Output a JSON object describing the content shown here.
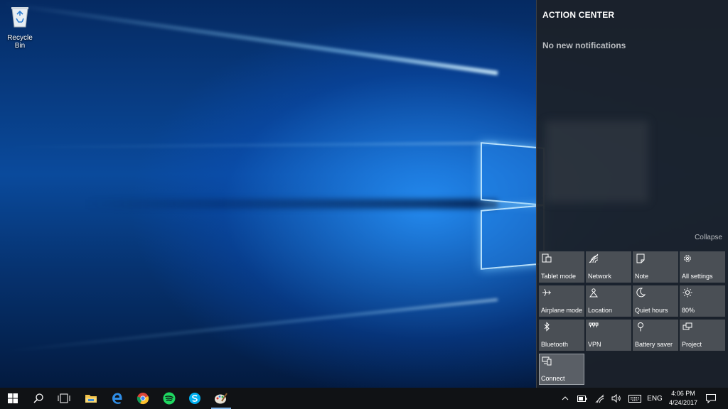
{
  "desktop": {
    "icons": [
      {
        "label": "Recycle Bin",
        "icon": "recycle-bin-icon"
      }
    ]
  },
  "action_center": {
    "title": "ACTION CENTER",
    "empty_message": "No new notifications",
    "collapse_label": "Collapse",
    "quick_actions": [
      {
        "label": "Tablet mode",
        "icon": "tablet-mode-icon"
      },
      {
        "label": "Network",
        "icon": "network-icon"
      },
      {
        "label": "Note",
        "icon": "note-icon"
      },
      {
        "label": "All settings",
        "icon": "gear-icon"
      },
      {
        "label": "Airplane mode",
        "icon": "airplane-icon"
      },
      {
        "label": "Location",
        "icon": "location-icon"
      },
      {
        "label": "Quiet hours",
        "icon": "moon-icon"
      },
      {
        "label": "80%",
        "icon": "brightness-icon"
      },
      {
        "label": "Bluetooth",
        "icon": "bluetooth-icon"
      },
      {
        "label": "VPN",
        "icon": "vpn-icon"
      },
      {
        "label": "Battery saver",
        "icon": "battery-saver-icon"
      },
      {
        "label": "Project",
        "icon": "project-icon"
      },
      {
        "label": "Connect",
        "icon": "connect-icon"
      }
    ]
  },
  "taskbar": {
    "pinned": [
      "start-icon",
      "search-icon",
      "task-view-icon",
      "file-explorer-icon",
      "edge-icon",
      "chrome-icon",
      "spotify-icon",
      "skype-icon",
      "paint-icon"
    ],
    "tray": {
      "language": "ENG",
      "time": "4:06 PM",
      "date": "4/24/2017"
    }
  },
  "colors": {
    "accent": "#7fb4e8",
    "tile": "#4a4f55",
    "action_center_bg": "#1c2128",
    "taskbar_bg": "#101215"
  }
}
